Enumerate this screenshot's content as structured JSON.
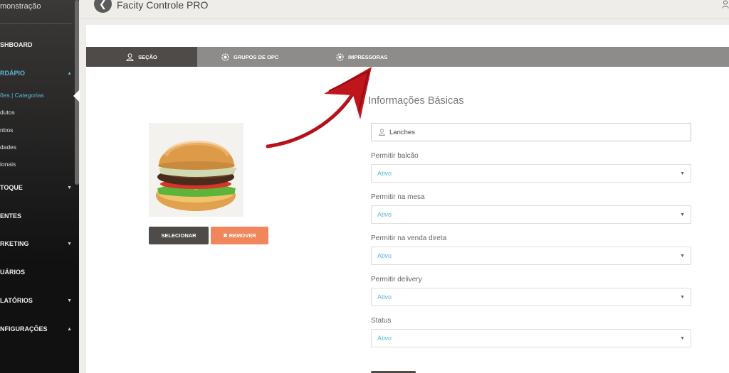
{
  "sidebar": {
    "brand": "monstração",
    "items": [
      {
        "label": "SHBOARD",
        "caret": ""
      },
      {
        "label": "RDÁPIO",
        "caret": "▲"
      },
      {
        "label": "TOQUE",
        "caret": "▼"
      },
      {
        "label": "ENTES",
        "caret": ""
      },
      {
        "label": "RKETING",
        "caret": "▼"
      },
      {
        "label": "UÁRIOS",
        "caret": ""
      },
      {
        "label": "LATÓRIOS",
        "caret": "▼"
      },
      {
        "label": "NFIGURAÇÕES",
        "caret": "▲"
      }
    ],
    "subitems": [
      "ões | Categorias",
      "dutos",
      "nbos",
      "dades",
      "ionais"
    ]
  },
  "header": {
    "back_icon": "chevron-left-icon",
    "title": "Facity Controle PRO",
    "user_icon": "user-icon"
  },
  "tabs": [
    {
      "label": "SEÇÃO",
      "icon": "user-icon"
    },
    {
      "label": "GRUPOS DE OPC",
      "icon": "gear-icon"
    },
    {
      "label": "IMPRESSORAS",
      "icon": "gear-icon"
    }
  ],
  "image_panel": {
    "select_label": "SELECIONAR",
    "remove_label": "✖ REMOVER"
  },
  "form": {
    "title": "Informações Básicas",
    "name_value": "Lanches",
    "fields": [
      {
        "label": "Permitir balcão",
        "value": "Ativo"
      },
      {
        "label": "Permitir na mesa",
        "value": "Ativo"
      },
      {
        "label": "Permitir na venda direta",
        "value": "Ativo"
      },
      {
        "label": "Permitir delivery",
        "value": "Ativo"
      },
      {
        "label": "Status",
        "value": "Ativo"
      }
    ]
  },
  "colors": {
    "accent": "#5bb6d6",
    "remove": "#f0875c",
    "dark": "#4e4b48",
    "arrow": "#c0151d"
  }
}
